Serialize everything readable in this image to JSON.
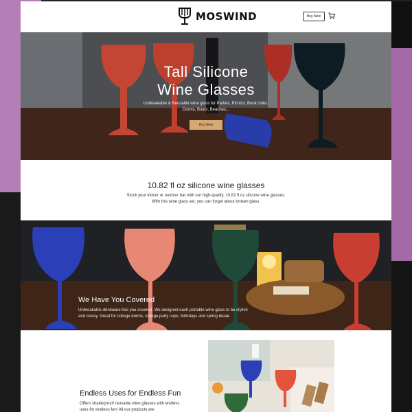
{
  "brand": {
    "name": "MOSWIND"
  },
  "header": {
    "buy_now": "Buy Now",
    "cart_icon": "cart-icon"
  },
  "hero": {
    "title_line1": "Tall Silicone",
    "title_line2": "Wine Glasses",
    "subtitle": "Unbreakable & Reusable wine glass for Parties, Picnics, Book clubs, Dorms, Boats, Beaches...",
    "button": "Buy Now"
  },
  "section_capacity": {
    "title": "10.82 fl oz silicone wine glasses",
    "body_line1": "Stock your indoor or outdoor bar with our high-quality, 10.82 fl oz silicone wine glasses.",
    "body_line2": "With this wine glass set, you can forget about broken glass."
  },
  "section_covered": {
    "title": "We Have You Covered",
    "body": "Unbreakable drinkware has you covered. We designed each portable wine glass to be stylish and classy. Great for college dorms, college party cups, birthdays and spring break."
  },
  "section_uses": {
    "title": "Endless Uses for Endless Fun",
    "body": "Offers shatterproof reusable wine glasses with endless uses for endless fun! All our products are"
  },
  "colors": {
    "accent_button": "#d7a972",
    "backdrop_purple": "#b47fb6",
    "glass_red": "#e4533c",
    "glass_blue": "#2a3fb8",
    "glass_green": "#1f4a3a",
    "glass_pink": "#e98775",
    "glass_navy": "#10202a"
  }
}
